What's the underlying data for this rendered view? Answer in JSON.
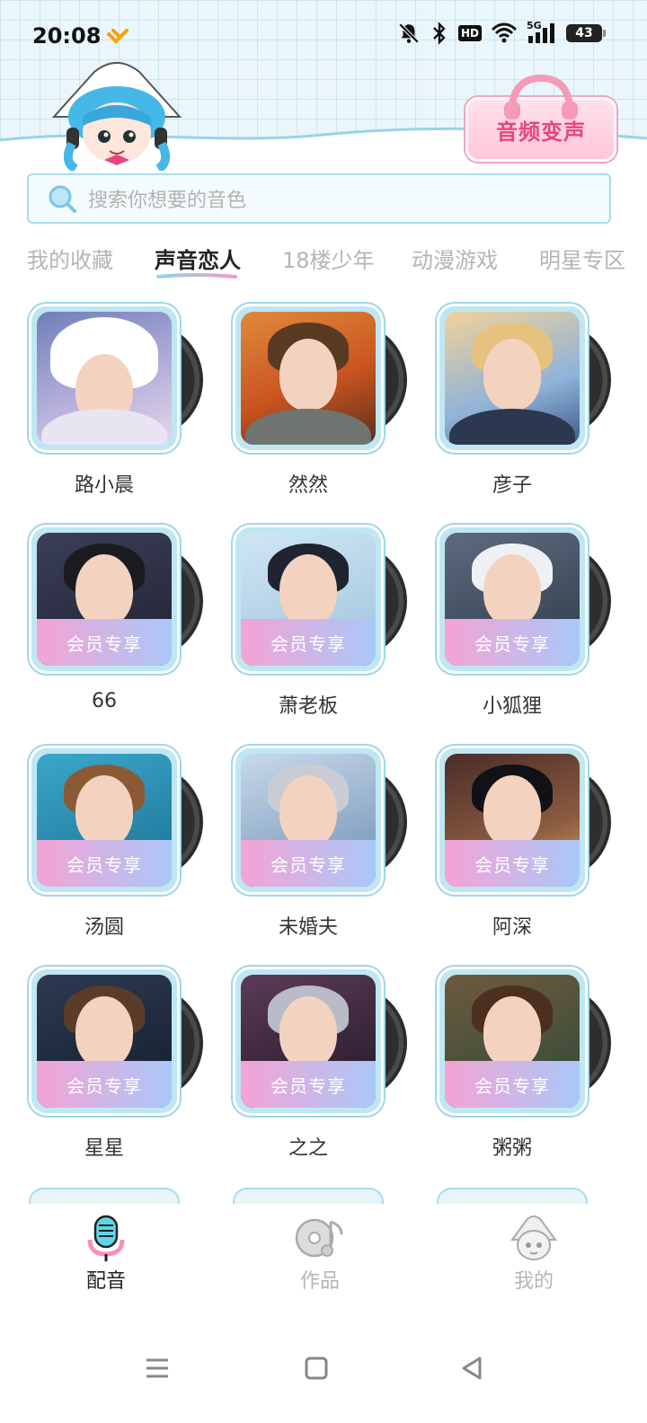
{
  "status": {
    "time": "20:08",
    "hd": "HD",
    "network": "5G",
    "battery": "43"
  },
  "banner": {
    "title": "音频变声"
  },
  "search": {
    "placeholder": "搜索你想要的音色"
  },
  "tabs": [
    {
      "label": "我的收藏",
      "active": false
    },
    {
      "label": "声音恋人",
      "active": true
    },
    {
      "label": "18楼少年",
      "active": false
    },
    {
      "label": "动漫游戏",
      "active": false
    },
    {
      "label": "明星专区",
      "active": false
    }
  ],
  "vip_label": "会员专享",
  "voices": [
    {
      "name": "路小晨",
      "vip": false
    },
    {
      "name": "然然",
      "vip": false
    },
    {
      "name": "彦子",
      "vip": false
    },
    {
      "name": "66",
      "vip": true
    },
    {
      "name": "萧老板",
      "vip": true
    },
    {
      "name": "小狐狸",
      "vip": true
    },
    {
      "name": "汤圆",
      "vip": true
    },
    {
      "name": "未婚夫",
      "vip": true
    },
    {
      "name": "阿深",
      "vip": true
    },
    {
      "name": "星星",
      "vip": true
    },
    {
      "name": "之之",
      "vip": true
    },
    {
      "name": "粥粥",
      "vip": true
    }
  ],
  "nav": [
    {
      "label": "配音",
      "active": true
    },
    {
      "label": "作品",
      "active": false
    },
    {
      "label": "我的",
      "active": false
    }
  ]
}
